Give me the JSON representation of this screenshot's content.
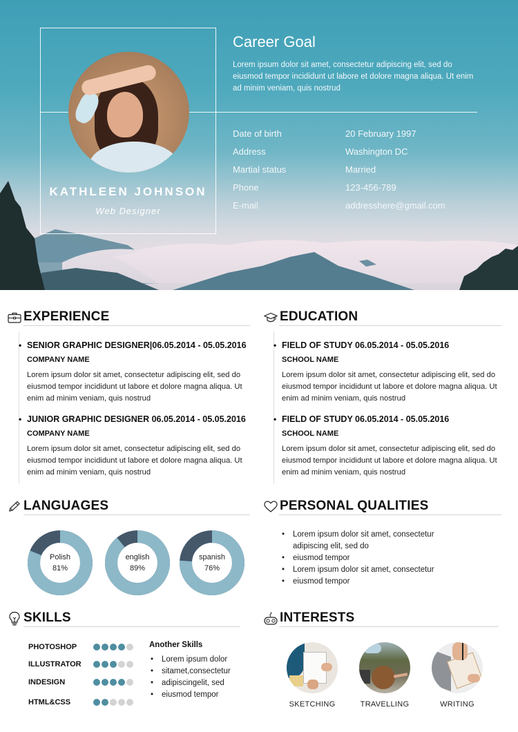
{
  "profile": {
    "name": "KATHLEEN JOHNSON",
    "job_title": "Web Designer",
    "photo_alt": "profile-photo"
  },
  "career_goal": {
    "title": "Career Goal",
    "text": "Lorem ipsum dolor sit amet, consectetur adipiscing elit, sed do eiusmod tempor incididunt ut labore et dolore magna aliqua. Ut enim ad minim veniam, quis nostrud"
  },
  "personal_info": [
    {
      "label": "Date of birth",
      "value": "20 February 1997"
    },
    {
      "label": "Address",
      "value": "Washington DC"
    },
    {
      "label": "Martial status",
      "value": "Married"
    },
    {
      "label": "Phone",
      "value": "123-456-789"
    },
    {
      "label": "E-mail",
      "value": "addresshere@gmail.com"
    }
  ],
  "experience": {
    "heading": "EXPERIENCE",
    "icon": "briefcase-icon",
    "items": [
      {
        "title": "SENIOR GRAPHIC DESIGNER|06.05.2014 - 05.05.2016",
        "company": "COMPANY NAME",
        "text": "Lorem ipsum dolor sit amet, consectetur adipiscing elit, sed do eiusmod tempor incididunt ut labore et dolore magna aliqua. Ut enim ad minim veniam, quis nostrud"
      },
      {
        "title": "JUNIOR GRAPHIC DESIGNER  06.05.2014 - 05.05.2016",
        "company": "COMPANY NAME",
        "text": "Lorem ipsum dolor sit amet, consectetur adipiscing elit, sed do eiusmod tempor incididunt ut labore et dolore magna aliqua. Ut enim ad minim veniam, quis nostrud"
      }
    ]
  },
  "education": {
    "heading": "EDUCATION",
    "icon": "graduation-cap-icon",
    "items": [
      {
        "title": "FIELD OF STUDY  06.05.2014 - 05.05.2016",
        "school": "SCHOOL NAME",
        "text": "Lorem ipsum dolor sit amet, consectetur adipiscing elit, sed do eiusmod tempor incididunt ut labore et dolore magna aliqua. Ut enim ad minim veniam, quis nostrud"
      },
      {
        "title": "FIELD OF STUDY  06.05.2014 - 05.05.2016",
        "school": "SCHOOL NAME",
        "text": "Lorem ipsum dolor sit amet, consectetur adipiscing elit, sed do eiusmod tempor incididunt ut labore et dolore magna aliqua. Ut enim ad minim veniam, quis nostrud"
      }
    ]
  },
  "languages": {
    "heading": "LANGUAGES",
    "icon": "pencil-icon",
    "colors": {
      "fill": "#8cb8c8",
      "remainder": "#44586a"
    },
    "items": [
      {
        "name": "Polish",
        "percent": 81,
        "label": "81%"
      },
      {
        "name": "english",
        "percent": 89,
        "label": "89%"
      },
      {
        "name": "spanish",
        "percent": 76,
        "label": "76%"
      }
    ]
  },
  "personal_qualities": {
    "heading": "PERSONAL QUALITIES",
    "icon": "heart-icon",
    "items": [
      "Lorem ipsum dolor sit amet, consectetur adipiscing elit, sed do",
      "eiusmod tempor",
      "Lorem ipsum dolor sit amet, consectetur",
      "eiusmod tempor"
    ]
  },
  "skills": {
    "heading": "SKILLS",
    "icon": "lightbulb-icon",
    "colors": {
      "on": "#4f8ea0",
      "off": "#d3d3d3"
    },
    "max": 5,
    "items": [
      {
        "name": "PHOTOSHOP",
        "level": 4
      },
      {
        "name": "ILLUSTRATOR",
        "level": 3
      },
      {
        "name": "INDESIGN",
        "level": 4
      },
      {
        "name": "HTML&CSS",
        "level": 2
      }
    ],
    "another_title": "Another Skills",
    "another_items": [
      "Lorem ipsum dolor",
      "sitamet,consectetur",
      "adipiscingelit, sed",
      "eiusmod tempor"
    ]
  },
  "interests": {
    "heading": "INTERESTS",
    "icon": "gamepad-icon",
    "items": [
      {
        "label": "SKETCHING",
        "icon": "sketching-photo"
      },
      {
        "label": "TRAVELLING",
        "icon": "travelling-photo"
      },
      {
        "label": "WRITING",
        "icon": "writing-photo"
      }
    ]
  }
}
